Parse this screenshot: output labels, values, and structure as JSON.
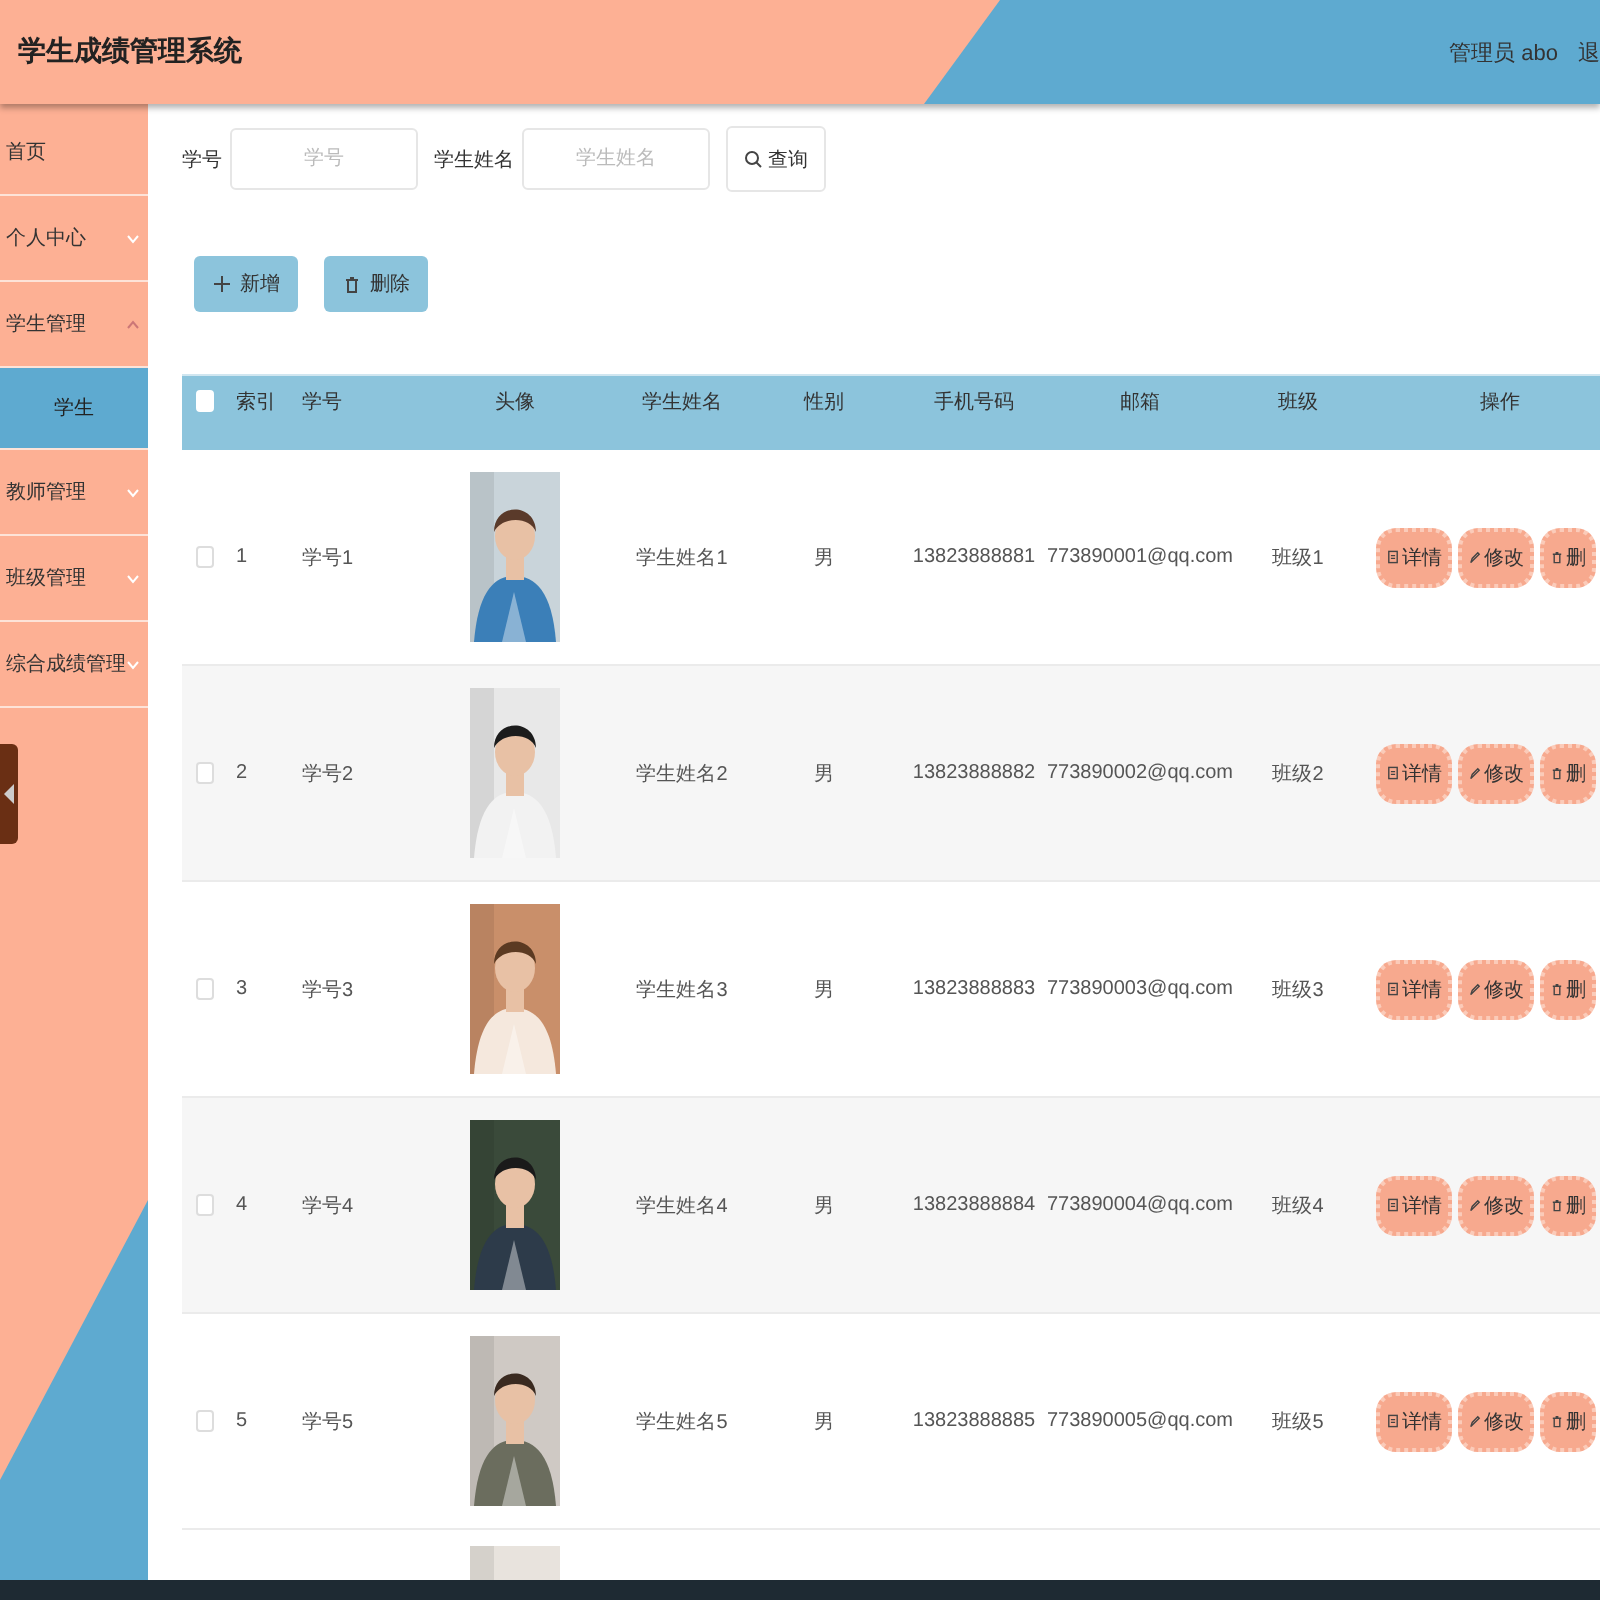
{
  "header": {
    "title": "学生成绩管理系统",
    "user": "管理员 abo",
    "logout": "退"
  },
  "sidebar": {
    "items": [
      {
        "kind": "link",
        "label": "首页"
      },
      {
        "kind": "group",
        "label": "个人中心",
        "expanded": false
      },
      {
        "kind": "group",
        "label": "学生管理",
        "expanded": true,
        "children": [
          {
            "label": "学生",
            "selected": true
          }
        ]
      },
      {
        "kind": "group",
        "label": "教师管理",
        "expanded": false
      },
      {
        "kind": "group",
        "label": "班级管理",
        "expanded": false
      },
      {
        "kind": "group",
        "label": "综合成绩管理",
        "expanded": false
      }
    ]
  },
  "search": {
    "fields": [
      {
        "label": "学号",
        "placeholder": "学号"
      },
      {
        "label": "学生姓名",
        "placeholder": "学生姓名"
      }
    ],
    "button": "查询"
  },
  "actions": [
    {
      "kind": "add",
      "label": "新增"
    },
    {
      "kind": "delete",
      "label": "删除"
    }
  ],
  "table": {
    "header_checked": false,
    "columns": [
      "索引",
      "学号",
      "头像",
      "学生姓名",
      "性别",
      "手机号码",
      "邮箱",
      "班级",
      "操作"
    ],
    "rows": [
      {
        "kind": "full",
        "checked": false,
        "index": "1",
        "student_no": "学号1",
        "name": "学生姓名1",
        "gender": "男",
        "phone": "13823888881",
        "email": "773890001@qq.com",
        "class": "班级1",
        "actions": [
          {
            "kind": "detail",
            "label": "详情"
          },
          {
            "kind": "edit",
            "label": "修改"
          },
          {
            "kind": "delete",
            "label": "删"
          }
        ]
      },
      {
        "kind": "full",
        "checked": false,
        "index": "2",
        "student_no": "学号2",
        "name": "学生姓名2",
        "gender": "男",
        "phone": "13823888882",
        "email": "773890002@qq.com",
        "class": "班级2",
        "actions": [
          {
            "kind": "detail",
            "label": "详情"
          },
          {
            "kind": "edit",
            "label": "修改"
          },
          {
            "kind": "delete",
            "label": "删"
          }
        ]
      },
      {
        "kind": "full",
        "checked": false,
        "index": "3",
        "student_no": "学号3",
        "name": "学生姓名3",
        "gender": "男",
        "phone": "13823888883",
        "email": "773890003@qq.com",
        "class": "班级3",
        "actions": [
          {
            "kind": "detail",
            "label": "详情"
          },
          {
            "kind": "edit",
            "label": "修改"
          },
          {
            "kind": "delete",
            "label": "删"
          }
        ]
      },
      {
        "kind": "full",
        "checked": false,
        "index": "4",
        "student_no": "学号4",
        "name": "学生姓名4",
        "gender": "男",
        "phone": "13823888884",
        "email": "773890004@qq.com",
        "class": "班级4",
        "actions": [
          {
            "kind": "detail",
            "label": "详情"
          },
          {
            "kind": "edit",
            "label": "修改"
          },
          {
            "kind": "delete",
            "label": "删"
          }
        ]
      },
      {
        "kind": "full",
        "checked": false,
        "index": "5",
        "student_no": "学号5",
        "name": "学生姓名5",
        "gender": "男",
        "phone": "13823888885",
        "email": "773890005@qq.com",
        "class": "班级5",
        "actions": [
          {
            "kind": "detail",
            "label": "详情"
          },
          {
            "kind": "edit",
            "label": "修改"
          },
          {
            "kind": "delete",
            "label": "删"
          }
        ]
      },
      {
        "kind": "partial"
      }
    ]
  }
}
